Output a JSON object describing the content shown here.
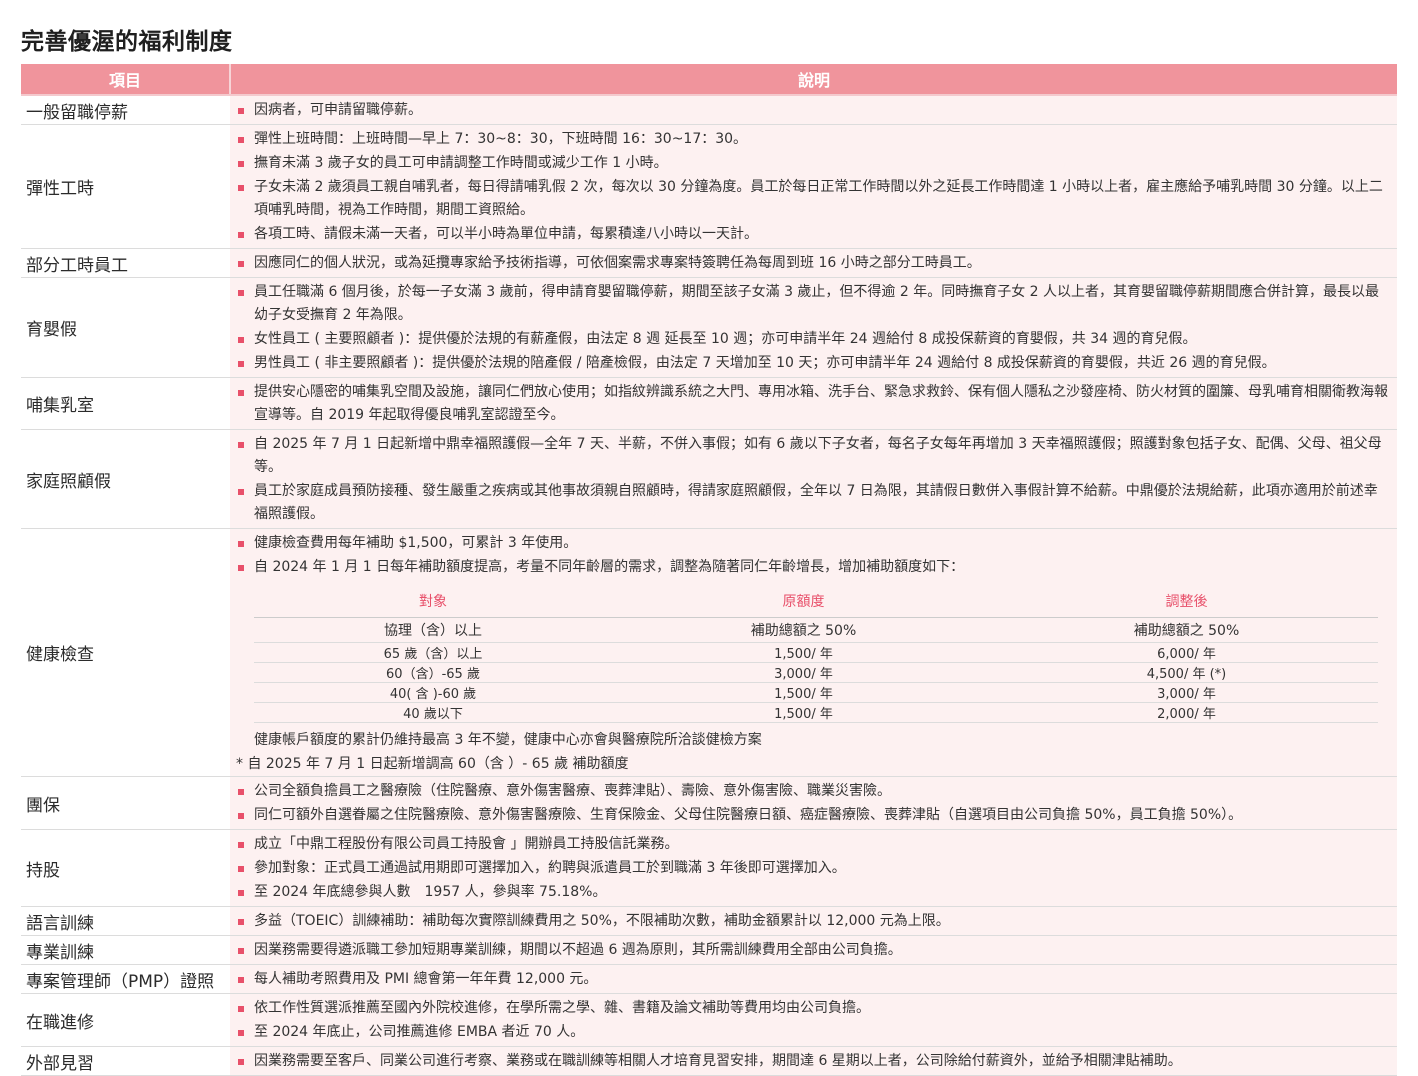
{
  "title": "完善優渥的福利制度",
  "headers": {
    "item": "項目",
    "desc": "說明"
  },
  "rows": [
    {
      "item": "一般留職停薪",
      "bullets": [
        "因病者，可申請留職停薪。"
      ]
    },
    {
      "item": "彈性工時",
      "bullets": [
        "彈性上班時間：上班時間—早上 7：30~8：30，下班時間 16：30~17：30。",
        "撫育未滿 3 歲子女的員工可申請調整工作時間或減少工作 1 小時。",
        "子女未滿 2 歲須員工親自哺乳者，每日得請哺乳假 2 次，每次以 30 分鐘為度。員工於每日正常工作時間以外之延長工作時間達 1 小時以上者，雇主應給予哺乳時間 30 分鐘。以上二項哺乳時間，視為工作時間，期間工資照給。",
        "各項工時、請假未滿一天者，可以半小時為單位申請，每累積達八小時以一天計。"
      ]
    },
    {
      "item": "部分工時員工",
      "bullets": [
        "因應同仁的個人狀況，或為延攬專家給予技術指導，可依個案需求專案特簽聘任為每周到班 16 小時之部分工時員工。"
      ]
    },
    {
      "item": "育嬰假",
      "bullets": [
        "員工任職滿 6 個月後，於每一子女滿 3 歲前，得申請育嬰留職停薪，期間至該子女滿 3 歲止，但不得逾 2 年。同時撫育子女 2 人以上者，其育嬰留職停薪期間應合併計算，最長以最幼子女受撫育 2 年為限。",
        "女性員工 ( 主要照顧者 )：提供優於法規的有薪產假，由法定 8 週 延長至 10 週；亦可申請半年 24 週給付 8 成投保薪資的育嬰假，共 34 週的育兒假。",
        "男性員工 ( 非主要照顧者 )：提供優於法規的陪產假 / 陪產檢假，由法定 7 天增加至 10 天；亦可申請半年 24 週給付 8 成投保薪資的育嬰假，共近 26 週的育兒假。"
      ]
    },
    {
      "item": "哺集乳室",
      "bullets": [
        "提供安心隱密的哺集乳空間及設施，讓同仁們放心使用；如指紋辨識系統之大門、專用冰箱、洗手台、緊急求救鈴、保有個人隱私之沙發座椅、防火材質的圍簾、母乳哺育相關衛教海報宣導等。自 2019 年起取得優良哺乳室認證至今。"
      ]
    },
    {
      "item": "家庭照顧假",
      "bullets": [
        "自 2025 年 7 月 1 日起新增中鼎幸福照護假—全年 7 天、半薪，不併入事假；如有 6 歲以下子女者，每名子女每年再增加 3 天幸福照護假；照護對象包括子女、配偶、父母、祖父母等。",
        "員工於家庭成員預防接種、發生嚴重之疾病或其他事故須親自照顧時，得請家庭照顧假，全年以 7 日為限，其請假日數併入事假計算不給薪。中鼎優於法規給薪，此項亦適用於前述幸福照護假。"
      ]
    },
    {
      "item": "健康檢查",
      "bullets": [
        "健康檢查費用每年補助 $1,500，可累計 3 年使用。",
        "自 2024 年 1 月 1 日每年補助額度提高，考量不同年齡層的需求，調整為隨著同仁年齡增長，增加補助額度如下："
      ]
    },
    {
      "item": "團保",
      "bullets": [
        "公司全額負擔員工之醫療險（住院醫療、意外傷害醫療、喪葬津貼）、壽險、意外傷害險、職業災害險。",
        "同仁可額外自選眷屬之住院醫療險、意外傷害醫療險、生育保險金、父母住院醫療日額、癌症醫療險、喪葬津貼（自選項目由公司負擔 50%，員工負擔 50%）。"
      ]
    },
    {
      "item": "持股",
      "bullets": [
        "成立「中鼎工程股份有限公司員工持股會 」開辦員工持股信託業務。",
        "參加對象：正式員工通過試用期即可選擇加入，約聘與派遣員工於到職滿 3 年後即可選擇加入。",
        "至 2024 年底總參與人數　1957 人，參與率 75.18%。"
      ]
    },
    {
      "item": "語言訓練",
      "bullets": [
        "多益（TOEIC）訓練補助：補助每次實際訓練費用之 50%，不限補助次數，補助金額累計以 12,000 元為上限。"
      ]
    },
    {
      "item": "專業訓練",
      "bullets": [
        "因業務需要得遴派職工參加短期專業訓練，期間以不超過 6 週為原則，其所需訓練費用全部由公司負擔。"
      ]
    },
    {
      "item": "專案管理師（PMP）證照",
      "bullets": [
        "每人補助考照費用及 PMI 總會第一年年費 12,000 元。"
      ]
    },
    {
      "item": "在職進修",
      "bullets": [
        "依工作性質選派推薦至國內外院校進修，在學所需之學、雜、書籍及論文補助等費用均由公司負擔。",
        "至 2024 年底止，公司推薦進修 EMBA 者近 70 人。"
      ]
    },
    {
      "item": "外部見習",
      "bullets": [
        "因業務需要至客戶、同業公司進行考察、業務或在職訓練等相關人才培育見習安排，期間達 6 星期以上者，公司除給付薪資外，並給予相關津貼補助。"
      ]
    }
  ],
  "health_table": {
    "headers": [
      "對象",
      "原額度",
      "調整後"
    ],
    "rows": [
      [
        "協理（含）以上",
        "補助總額之 50%",
        "補助總額之 50%"
      ],
      [
        "65 歲（含）以上",
        "1,500/ 年",
        "6,000/ 年"
      ],
      [
        "60（含）-65 歲",
        "3,000/ 年",
        "4,500/ 年 (*)"
      ],
      [
        "40( 含 )-60 歲",
        "1,500/ 年",
        "3,000/ 年"
      ],
      [
        "40 歲以下",
        "1,500/ 年",
        "2,000/ 年"
      ]
    ],
    "note": "健康帳戶額度的累計仍維持最高 3 年不變，健康中心亦會與醫療院所洽談健檢方案",
    "footnote": "* 自 2025 年 7 月 1 日起新增調高 60（含 ）- 65 歲 補助額度"
  },
  "colors": {
    "header_bg": "#f0949c",
    "bullet": "#e8506a",
    "desc_bg": "#fdf1f1"
  }
}
